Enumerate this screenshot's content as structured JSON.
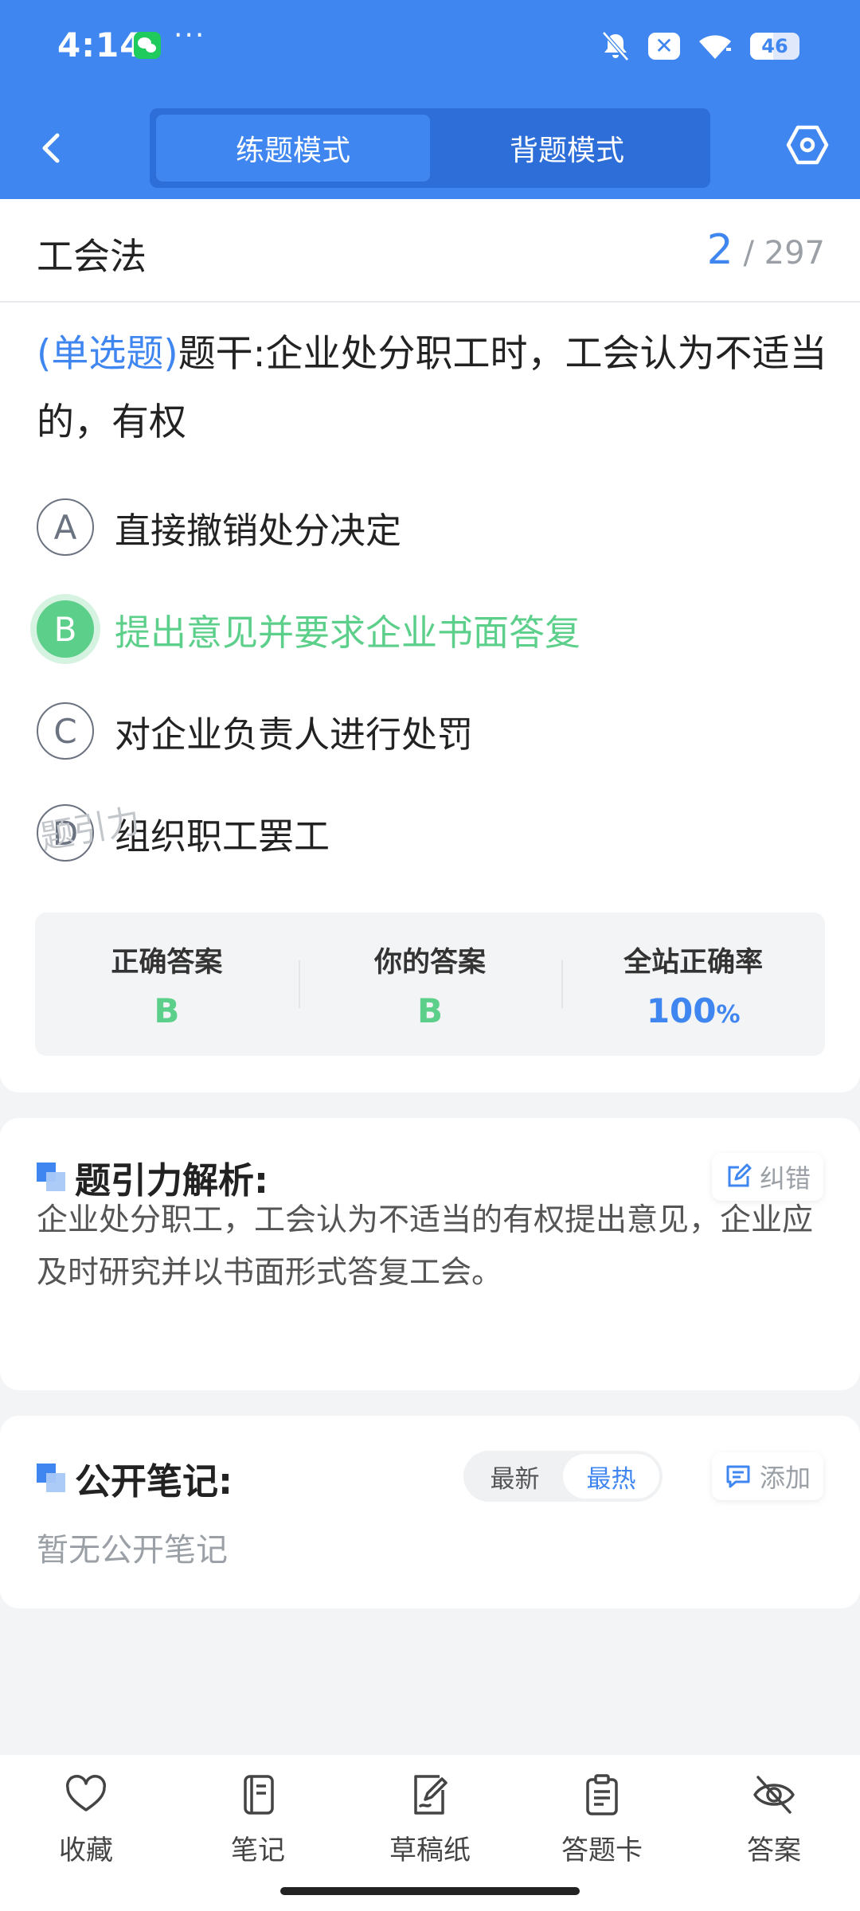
{
  "status_bar": {
    "time": "4:14",
    "dots": "···",
    "battery": "46"
  },
  "header": {
    "modes": [
      "练题模式",
      "背题模式"
    ],
    "active_mode": 0
  },
  "question": {
    "subject": "工会法",
    "current": "2",
    "total": "/ 297",
    "type": "(单选题)",
    "stem": "题干:企业处分职工时，工会认为不适当的，有权",
    "options": [
      {
        "letter": "A",
        "text": "直接撤销处分决定",
        "state": "normal"
      },
      {
        "letter": "B",
        "text": "提出意见并要求企业书面答复",
        "state": "correct"
      },
      {
        "letter": "C",
        "text": "对企业负责人进行处罚",
        "state": "normal"
      },
      {
        "letter": "D",
        "text": "组织职工罢工",
        "state": "normal"
      }
    ],
    "answer": {
      "correct_label": "正确答案",
      "correct_value": "B",
      "yours_label": "你的答案",
      "yours_value": "B",
      "rate_label": "全站正确率",
      "rate_value": "100",
      "rate_unit": "%"
    },
    "watermark": "题引力"
  },
  "explanation": {
    "title": "题引力解析:",
    "report_label": "纠错",
    "text": "企业处分职工，工会认为不适当的有权提出意见，企业应及时研究并以书面形式答复工会。"
  },
  "notes": {
    "title": "公开笔记:",
    "sort": [
      "最新",
      "最热"
    ],
    "active_sort": 1,
    "add_label": "添加",
    "empty": "暂无公开笔记"
  },
  "bottom_tabs": [
    {
      "label": "收藏",
      "icon": "heart-icon"
    },
    {
      "label": "笔记",
      "icon": "notebook-icon"
    },
    {
      "label": "草稿纸",
      "icon": "draft-icon"
    },
    {
      "label": "答题卡",
      "icon": "clipboard-icon"
    },
    {
      "label": "答案",
      "icon": "eye-off-icon"
    }
  ],
  "colors": {
    "primary": "#3f86f0",
    "correct": "#5ccf8a",
    "background": "#f3f4f6"
  }
}
